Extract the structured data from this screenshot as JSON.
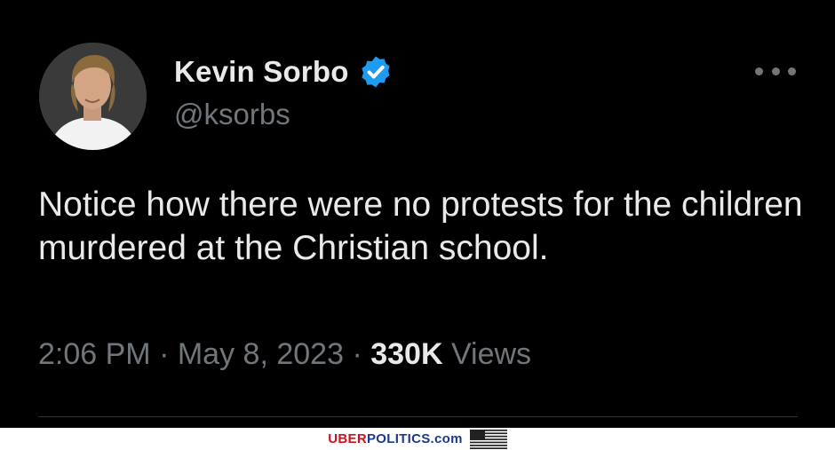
{
  "author": {
    "display_name": "Kevin Sorbo",
    "handle": "@ksorbs",
    "verified": true,
    "verified_color": "#1d9bf0"
  },
  "tweet": {
    "text": "Notice how there were no protests for the children murdered at the Christian school.",
    "time": "2:06 PM",
    "separator": "·",
    "date": "May 8, 2023",
    "views_count": "330K",
    "views_label": "Views"
  },
  "icons": {
    "more": "more-options-icon",
    "verified": "verified-badge-icon",
    "flag": "us-flag-icon"
  },
  "footer": {
    "brand_part1": "UBER",
    "brand_part2": "POLITICS",
    "brand_part3": ".com"
  },
  "colors": {
    "background": "#000000",
    "text_primary": "#e7e9ea",
    "text_secondary": "#71767b",
    "brand_red": "#d0101a",
    "brand_blue": "#1a3a8f"
  }
}
